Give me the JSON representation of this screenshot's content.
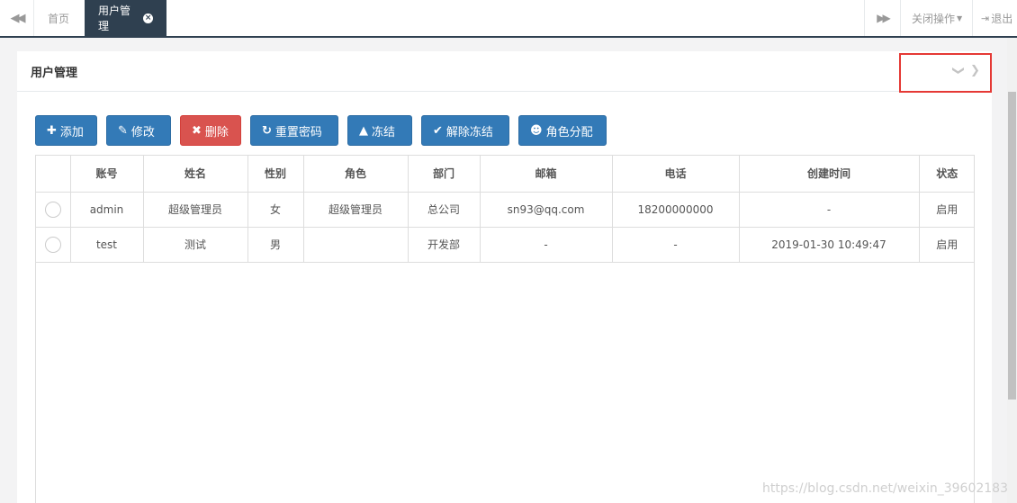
{
  "tabs": {
    "prev_icon": "double-chevron-left",
    "next_icon": "double-chevron-right",
    "home_label": "首页",
    "active_label": "用户管理",
    "close_ops_label": "关闭操作",
    "logout_label": "退出"
  },
  "panel": {
    "title": "用户管理"
  },
  "toolbar": {
    "add": "添加",
    "edit": "修改",
    "delete": "删除",
    "reset_password": "重置密码",
    "freeze": "冻结",
    "unfreeze": "解除冻结",
    "assign_role": "角色分配"
  },
  "table": {
    "headers": [
      "账号",
      "姓名",
      "性别",
      "角色",
      "部门",
      "邮箱",
      "电话",
      "创建时间",
      "状态"
    ],
    "rows": [
      [
        "admin",
        "超级管理员",
        "女",
        "超级管理员",
        "总公司",
        "sn93@qq.com",
        "18200000000",
        "-",
        "启用"
      ],
      [
        "test",
        "测试",
        "男",
        "",
        "开发部",
        "-",
        "-",
        "2019-01-30 10:49:47",
        "启用"
      ]
    ]
  },
  "watermark": "https://blog.csdn.net/weixin_39602183",
  "colors": {
    "primary": "#337ab7",
    "danger": "#d9534f",
    "nav_dark": "#2f4050",
    "highlight_box": "#e53935"
  }
}
